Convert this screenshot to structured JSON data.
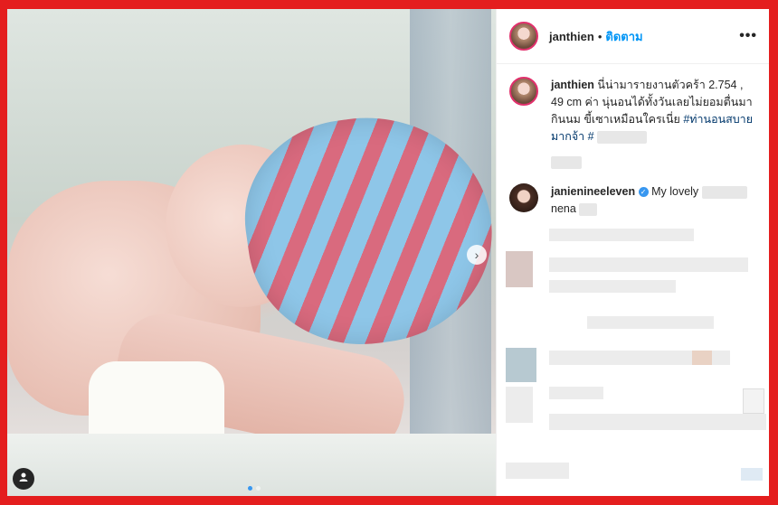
{
  "post": {
    "image_alt": "newborn baby sleeping in a knitted blue and pink striped hat",
    "carousel": {
      "current": 1,
      "total": 2,
      "next_icon": "›"
    },
    "user_tag_icon": "person-icon"
  },
  "header": {
    "username": "janthien",
    "separator": "•",
    "follow_label": "ติดตาม",
    "more_icon": "•••"
  },
  "caption": {
    "username": "janthien",
    "text": "นี่น่ามารายงานตัวคร้า 2.754 , 49 cm ค่า นุ่นอนได้ทั้งวันเลยไม่ยอมตื่นมากินนม ขี้เซาเหมือนใครเนี่ย",
    "hashtag": "#ท่านอนสบายมากจ้า",
    "hashtag2": "#"
  },
  "comments": [
    {
      "username": "janienineeleven",
      "verified": true,
      "text": "My lovely",
      "text2": "nena"
    }
  ],
  "colors": {
    "follow": "#0095f6",
    "hashtag": "#00376b",
    "frame": "#e41e1e",
    "verified": "#3897f0"
  }
}
